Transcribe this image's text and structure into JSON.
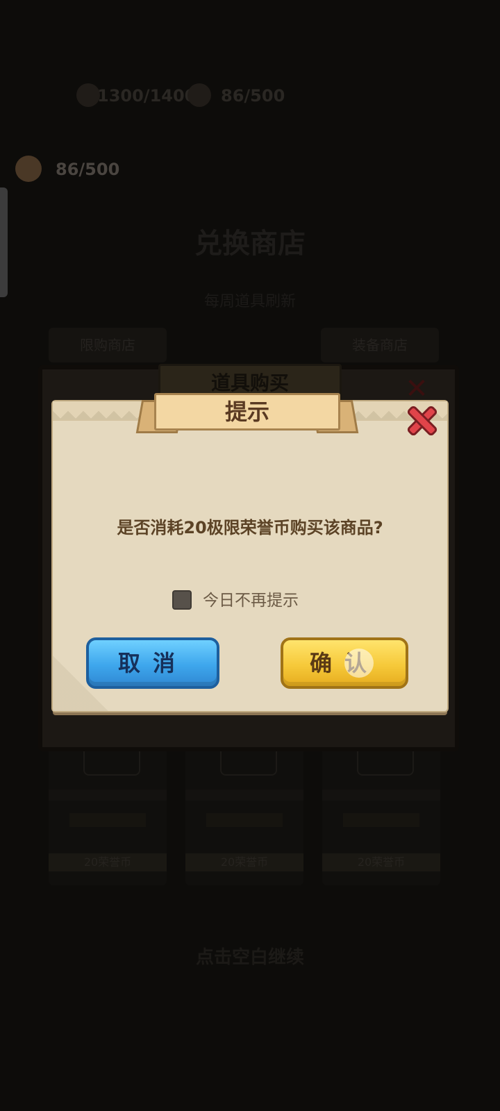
{
  "background": {
    "resource_stamina": "1300/1400",
    "resource_coins_top": "86/500",
    "honor_coins": "86/500",
    "shop_title": "兑换商店",
    "shop_subtitle": "每周道具刷新",
    "tabs": [
      "限购商店",
      "",
      "装备商店"
    ],
    "cards": [
      {
        "bar": "20荣誉币"
      },
      {
        "bar": "20荣誉币"
      },
      {
        "bar": "20荣誉币"
      }
    ],
    "bottom_hint": "点击空白继续"
  },
  "purchase_dialog": {
    "title": "道具购买"
  },
  "prompt": {
    "title": "提示",
    "message": "是否消耗20极限荣誉币购买该商品?",
    "checkbox_label": "今日不再提示",
    "checkbox_checked": false,
    "cancel_label": "取消",
    "confirm_label": "确认"
  },
  "colors": {
    "cancel_button": "#3ea6ec",
    "confirm_button": "#f6c93a",
    "dialog_bg": "#e5d9bf",
    "close_button": "#e0444a"
  }
}
